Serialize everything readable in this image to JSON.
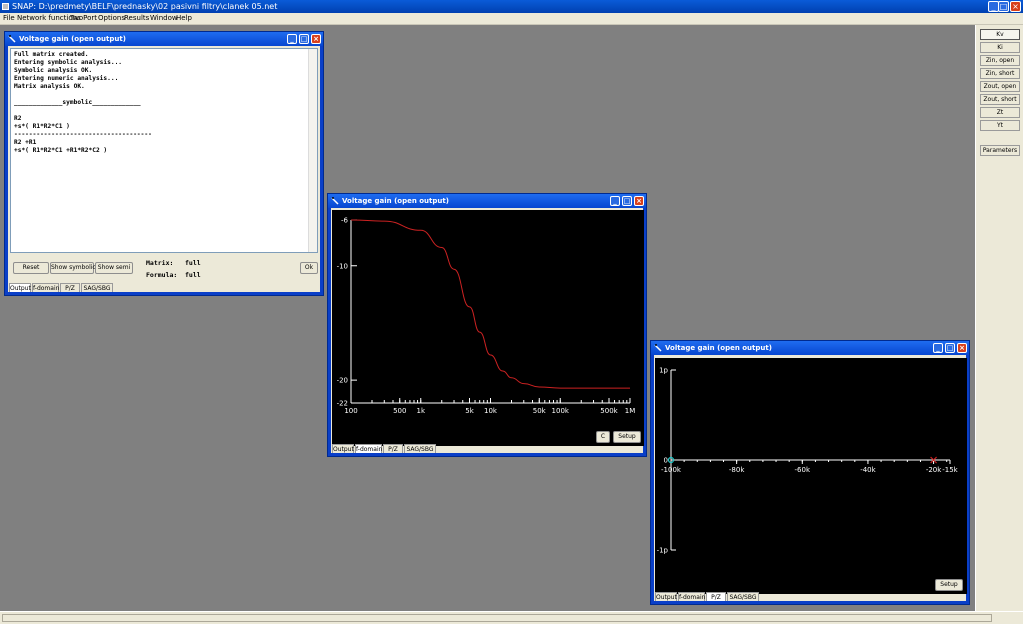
{
  "app": {
    "title": "SNAP: D:\\predmety\\BELF\\prednasky\\02 pasivni filtry\\clanek 05.net",
    "menu": [
      "File",
      "Network functions",
      "TwoPort",
      "Options",
      "Results",
      "Window",
      "Help"
    ],
    "window_controls": {
      "min": "_",
      "max": "□",
      "close": "×"
    }
  },
  "right_panel": {
    "buttons": [
      "Kv",
      "Ki",
      "Zin, open",
      "Zin, short",
      "Zout, open",
      "Zout, short",
      "Zt",
      "Yt"
    ],
    "active": "Kv",
    "params_label": "Parameters"
  },
  "win1": {
    "title": "Voltage gain (open output)",
    "console_text": "Full matrix created.\nEntering symbolic analysis...\nSymbolic analysis OK.\nEntering numeric analysis...\nMatrix analysis OK.\n\n_____________symbolic_____________\n\nR2\n+s*( R1*R2*C1 )\n-------------------------------------\nR2 +R1\n+s*( R1*R2*C1 +R1*R2*C2 )",
    "buttons": {
      "reset": "Reset",
      "show_symbolic": "Show symbolic",
      "show_semi": "Show semi",
      "ok": "Ok"
    },
    "matrix_label": "Matrix:",
    "matrix_value": "full",
    "formula_label": "Formula:",
    "formula_value": "full",
    "tabs": [
      "Output",
      "f-domain",
      "P/Z",
      "SAG/SBG"
    ],
    "active_tab": "Output"
  },
  "win2": {
    "title": "Voltage gain (open output)",
    "buttons": {
      "c": "C",
      "setup": "Setup"
    },
    "tabs": [
      "Output",
      "f-domain",
      "P/Z",
      "SAG/SBG"
    ],
    "active_tab": "f-domain",
    "chart_data": {
      "type": "line",
      "xscale": "log",
      "x_ticks": [
        "100",
        "500",
        "1k",
        "5k",
        "10k",
        "50k",
        "100k",
        "500k",
        "1M"
      ],
      "y_ticks": [
        "-6",
        "-10",
        "-20",
        "-22"
      ],
      "ylim": [
        -22,
        -6
      ],
      "xlim": [
        100,
        1000000
      ],
      "series": [
        {
          "color": "#cc2222",
          "x": [
            100,
            300,
            1000,
            2000,
            3000,
            5000,
            7000,
            10000,
            15000,
            20000,
            30000,
            50000,
            100000,
            300000,
            1000000
          ],
          "y": [
            -6.0,
            -6.1,
            -6.9,
            -8.4,
            -10.3,
            -13.6,
            -15.8,
            -17.8,
            -19.2,
            -19.8,
            -20.3,
            -20.6,
            -20.7,
            -20.7,
            -20.7
          ]
        }
      ]
    }
  },
  "win3": {
    "title": "Voltage gain (open output)",
    "buttons": {
      "setup": "Setup"
    },
    "tabs": [
      "Output",
      "f-domain",
      "P/Z",
      "SAG/SBG"
    ],
    "active_tab": "P/Z",
    "chart_data": {
      "type": "scatter",
      "x_ticks": [
        "-100k",
        "-80k",
        "-60k",
        "-40k",
        "-20k",
        "-15k"
      ],
      "y_ticks": [
        "1p",
        "0",
        "-1p"
      ],
      "xlim": [
        -100000,
        -15000
      ],
      "ylim": [
        -1,
        1
      ],
      "zeros": [
        {
          "x": -100000,
          "y": 0,
          "color": "#22cccc"
        }
      ],
      "poles": [
        {
          "x": -20000,
          "y": 0,
          "color": "#cc2222"
        }
      ]
    }
  }
}
